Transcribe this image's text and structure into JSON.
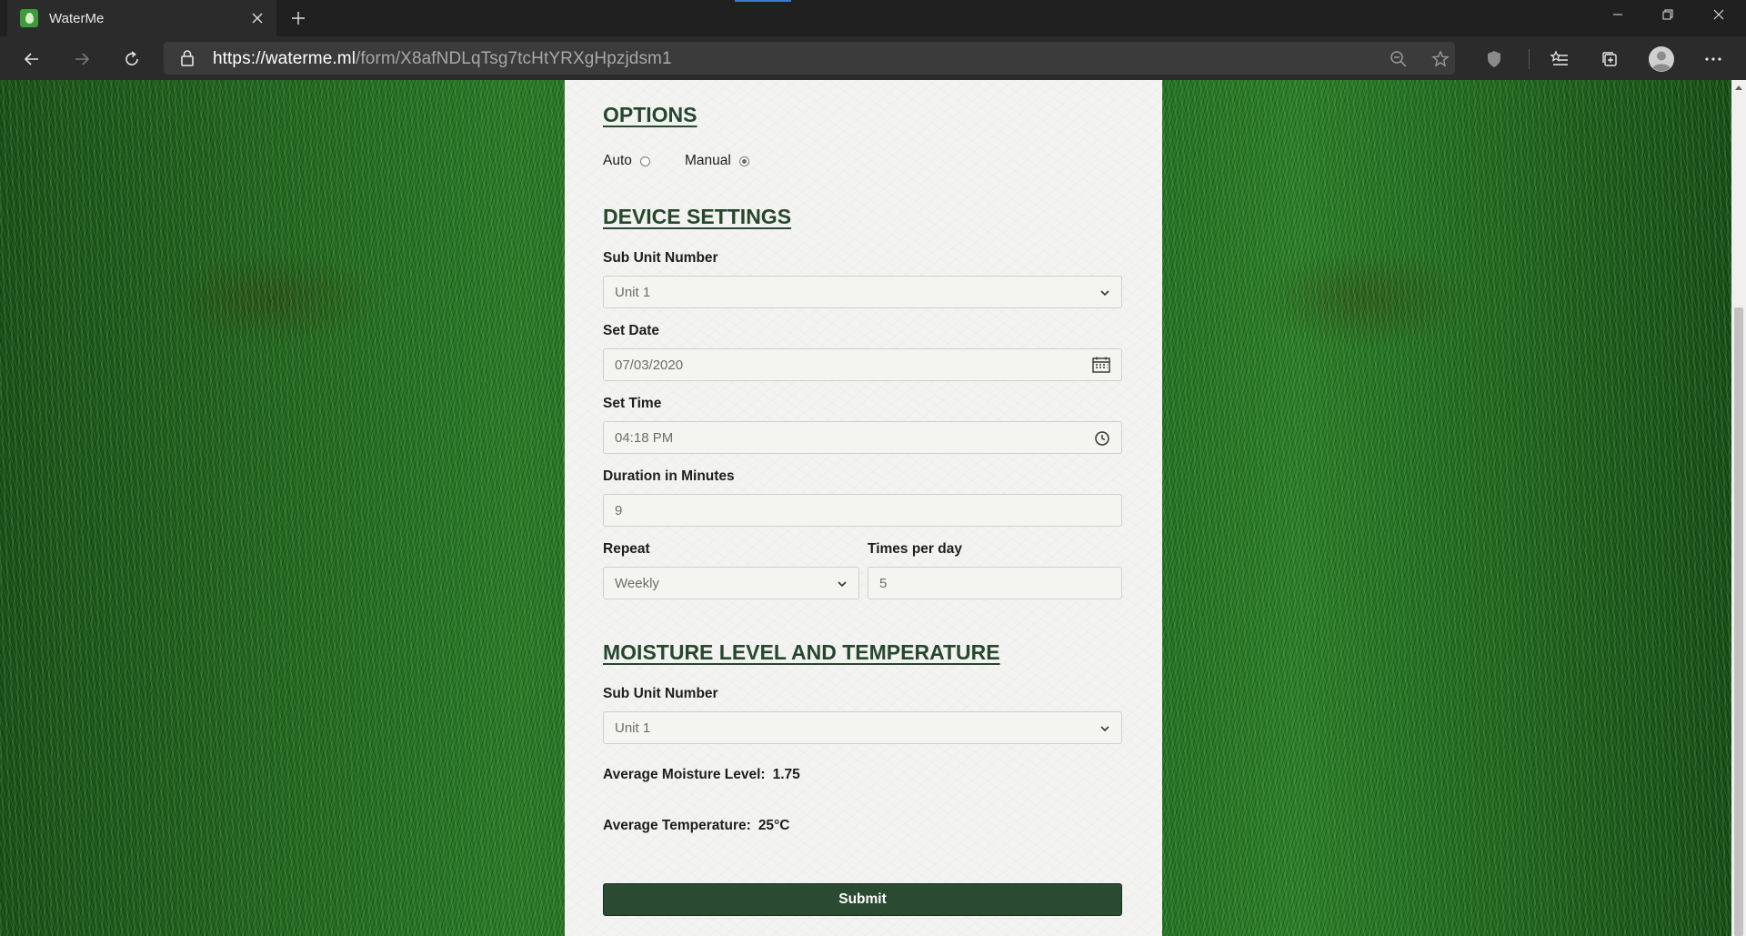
{
  "browser": {
    "tab_title": "WaterMe",
    "url_host": "https://waterme.ml",
    "url_path": "/form/X8afNDLqTsg7tcHtYRXgHpzjdsm1"
  },
  "options": {
    "title": "OPTIONS",
    "auto_label": "Auto",
    "manual_label": "Manual",
    "selected": "Manual"
  },
  "device_settings": {
    "title": "DEVICE SETTINGS",
    "sub_unit_label": "Sub Unit Number",
    "sub_unit_value": "Unit 1",
    "date_label": "Set Date",
    "date_value": "07/03/2020",
    "time_label": "Set Time",
    "time_value": "04:18 PM",
    "duration_label": "Duration in Minutes",
    "duration_value": "9",
    "repeat_label": "Repeat",
    "repeat_value": "Weekly",
    "times_label": "Times per day",
    "times_value": "5"
  },
  "moisture": {
    "title": "MOISTURE LEVEL AND TEMPERATURE",
    "sub_unit_label": "Sub Unit Number",
    "sub_unit_value": "Unit 1",
    "moisture_label": "Average Moisture Level:",
    "moisture_value": "1.75",
    "temperature_label": "Average Temperature:",
    "temperature_value": "25°C"
  },
  "submit_label": "Submit",
  "colors": {
    "heading": "#26472d",
    "submit_bg": "#2b4a32",
    "panel_bg": "#f3f4f1"
  }
}
